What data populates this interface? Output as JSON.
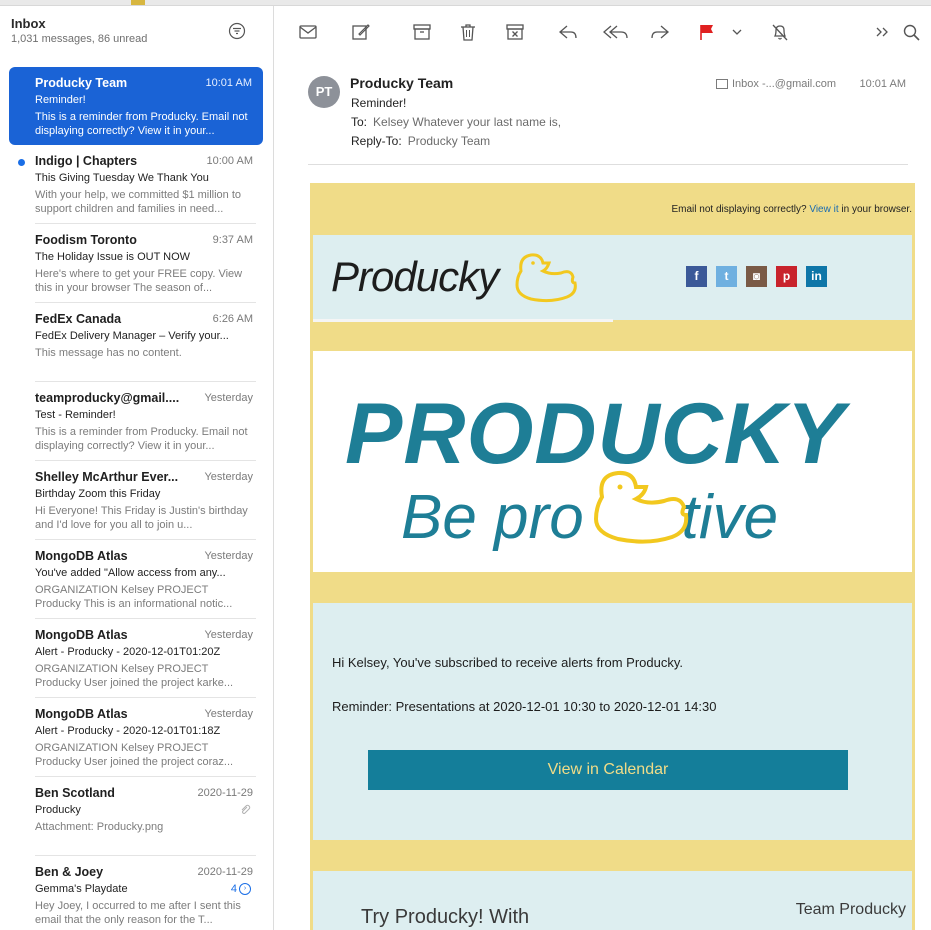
{
  "sidebar": {
    "title": "Inbox",
    "subtitle": "1,031 messages, 86 unread",
    "messages": [
      {
        "sender": "Producky Team",
        "time": "10:01 AM",
        "subject": "Reminder!",
        "preview": "This is a reminder from Producky. Email not displaying correctly? View it in your..."
      },
      {
        "sender": "Indigo | Chapters",
        "time": "10:00 AM",
        "subject": "This Giving Tuesday We Thank You",
        "preview": "With your help, we committed $1 million to support children and families in need..."
      },
      {
        "sender": "Foodism Toronto",
        "time": "9:37 AM",
        "subject": "The Holiday Issue is OUT NOW",
        "preview": "Here's where to get your FREE copy. View this in your browser The season of..."
      },
      {
        "sender": "FedEx Canada",
        "time": "6:26 AM",
        "subject": "FedEx Delivery Manager – Verify your...",
        "preview": "This message has no content."
      },
      {
        "sender": "teamproducky@gmail....",
        "time": "Yesterday",
        "subject": "Test - Reminder!",
        "preview": "This is a reminder from Producky. Email not displaying correctly? View it in your..."
      },
      {
        "sender": "Shelley McArthur Ever...",
        "time": "Yesterday",
        "subject": "Birthday Zoom this Friday",
        "preview": "Hi Everyone! This Friday is Justin's birthday and I'd love for you all to join u..."
      },
      {
        "sender": "MongoDB Atlas",
        "time": "Yesterday",
        "subject": "You've added \"Allow access from any...",
        "preview": "ORGANIZATION Kelsey PROJECT Producky This is an informational notic..."
      },
      {
        "sender": "MongoDB Atlas",
        "time": "Yesterday",
        "subject": "Alert - Producky - 2020-12-01T01:20Z",
        "preview": "ORGANIZATION Kelsey PROJECT Producky User joined the project karke..."
      },
      {
        "sender": "MongoDB Atlas",
        "time": "Yesterday",
        "subject": "Alert - Producky - 2020-12-01T01:18Z",
        "preview": "ORGANIZATION Kelsey PROJECT Producky User joined the project coraz..."
      },
      {
        "sender": "Ben Scotland",
        "time": "2020-11-29",
        "subject": "Producky",
        "preview": "Attachment: Producky.png"
      },
      {
        "sender": "Ben & Joey",
        "time": "2020-11-29",
        "subject": "Gemma's Playdate",
        "preview": "Hey Joey, I occurred to me after I sent this email that the only reason for the T...",
        "count": "4"
      }
    ]
  },
  "header": {
    "avatar": "PT",
    "from": "Producky Team",
    "subject": "Reminder!",
    "to_label": "To:",
    "to_value": "Kelsey Whatever your last name is,",
    "reply_label": "Reply-To:",
    "reply_value": "Producky Team",
    "mailbox": "Inbox -...@gmail.com",
    "time": "10:01 AM"
  },
  "email": {
    "notice_pre": "Email not displaying correctly?",
    "notice_link": "View it",
    "notice_post": "in your browser.",
    "brand": "Producky",
    "hero_title": "PRODUCKY",
    "hero_tag_pre": "Be pro",
    "hero_tag_post": "tive",
    "greeting": "Hi Kelsey, You've subscribed to receive alerts from Producky.",
    "reminder": "Reminder: Presentations at 2020-12-01 10:30 to 2020-12-01 14:30",
    "cta": "View in Calendar",
    "bottom_left": "Try Producky! With",
    "bottom_right": "Team Producky"
  },
  "icons": {
    "socials": [
      "facebook-icon",
      "twitter-icon",
      "instagram-icon",
      "pinterest-icon",
      "linkedin-icon"
    ]
  },
  "colors": {
    "selected": "#1a63d6",
    "email_yellow": "#f0dc88",
    "email_blue": "#ddeef0",
    "teal": "#1e7e96",
    "flag": "#e02020",
    "duck": "#f2c81f"
  }
}
